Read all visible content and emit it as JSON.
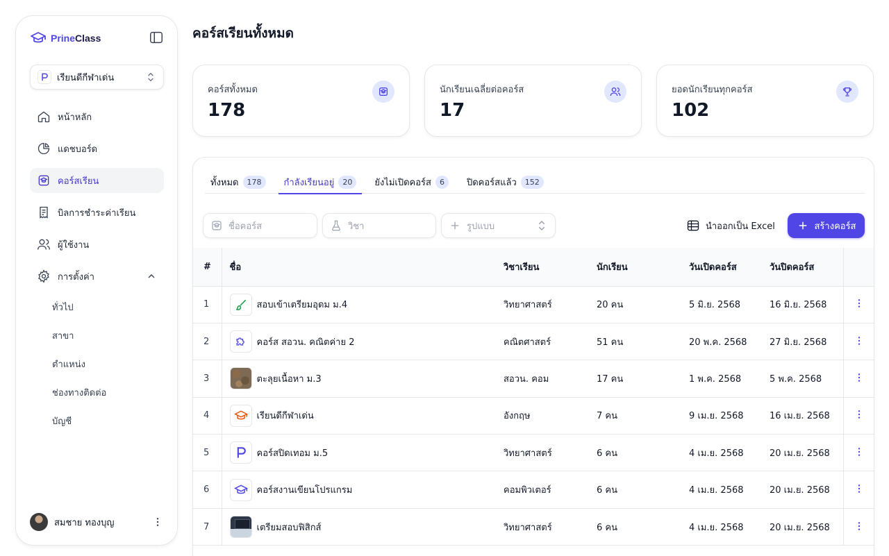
{
  "brand": {
    "name_prefix": "Prine",
    "name_suffix": "Class"
  },
  "school_selector": {
    "value": "เรียนดีกีฬาเด่น"
  },
  "nav": {
    "items": [
      {
        "label": "หน้าหลัก",
        "icon": "home-icon"
      },
      {
        "label": "แดชบอร์ด",
        "icon": "pie-chart-icon"
      },
      {
        "label": "คอร์สเรียน",
        "icon": "course-icon",
        "active": true
      },
      {
        "label": "บิลการชำระค่าเรียน",
        "icon": "receipt-icon"
      },
      {
        "label": "ผู้ใช้งาน",
        "icon": "users-icon"
      },
      {
        "label": "การตั้งค่า",
        "icon": "gear-icon",
        "expanded": true
      }
    ],
    "settings_sub": [
      "ทั่วไป",
      "สาขา",
      "ตำแหน่ง",
      "ช่องทางติดต่อ",
      "บัญชี"
    ]
  },
  "user": {
    "name": "สมชาย ทองบุญ"
  },
  "page": {
    "title": "คอร์สเรียนทั้งหมด"
  },
  "stats": [
    {
      "label": "คอร์สทั้งหมด",
      "value": "178",
      "icon": "course-icon"
    },
    {
      "label": "นักเรียนเฉลี่ยต่อคอร์ส",
      "value": "17",
      "icon": "users-icon"
    },
    {
      "label": "ยอดนักเรียนทุกคอร์ส",
      "value": "102",
      "icon": "trophy-icon"
    }
  ],
  "tabs": [
    {
      "label": "ทั้งหมด",
      "count": "178"
    },
    {
      "label": "กำลังเรียนอยู่",
      "count": "20",
      "active": true
    },
    {
      "label": "ยังไม่เปิดคอร์ส",
      "count": "6"
    },
    {
      "label": "ปิดคอร์สแล้ว",
      "count": "152"
    }
  ],
  "filters": {
    "course_name_placeholder": "ชื่อคอร์ส",
    "subject_placeholder": "วิชา",
    "format_placeholder": "รูปแบบ"
  },
  "actions": {
    "export_label": "นำออกเป็น Excel",
    "create_label": "สร้างคอร์ส"
  },
  "table": {
    "headers": {
      "num": "#",
      "name": "ชื่อ",
      "subject": "วิชาเรียน",
      "students": "นักเรียน",
      "open_date": "วันเปิดคอร์ส",
      "close_date": "วันปิดคอร์ส"
    },
    "rows": [
      {
        "num": "1",
        "name": "สอบเข้าเตรียมอุดม ม.4",
        "subject": "วิทยาศาสตร์",
        "students": "20 คน",
        "open_date": "5 มิ.ย. 2568",
        "close_date": "16 มิ.ย. 2568",
        "thumb": "brush-icon"
      },
      {
        "num": "2",
        "name": "คอร์ส สอวน. คณิตค่าย 2",
        "subject": "คณิตศาสตร์",
        "students": "51 คน",
        "open_date": "20 พ.ค. 2568",
        "close_date": "27 มิ.ย. 2568",
        "thumb": "puzzle-icon"
      },
      {
        "num": "3",
        "name": "ตะลุยเนื้อหา ม.3",
        "subject": "สอวน. คอม",
        "students": "17 คน",
        "open_date": "1 พ.ค. 2568",
        "close_date": "5 พ.ค. 2568",
        "thumb": "rock-photo"
      },
      {
        "num": "4",
        "name": "เรียนดีกีฬาเด่น",
        "subject": "อังกฤษ",
        "students": "7 คน",
        "open_date": "9 เม.ย. 2568",
        "close_date": "16 เม.ย. 2568",
        "thumb": "graduation-cap-icon"
      },
      {
        "num": "5",
        "name": "คอร์สปิดเทอม ม.5",
        "subject": "วิทยาศาสตร์",
        "students": "6 คน",
        "open_date": "4 เม.ย. 2568",
        "close_date": "20 เม.ย. 2568",
        "thumb": "p-logo-icon"
      },
      {
        "num": "6",
        "name": "คอร์สงานเขียนโปรแกรม",
        "subject": "คอมพิวเตอร์",
        "students": "6 คน",
        "open_date": "4 เม.ย. 2568",
        "close_date": "20 เม.ย. 2568",
        "thumb": "graduation-cap-icon"
      },
      {
        "num": "7",
        "name": "เตรียมสอบฟิสิกส์",
        "subject": "วิทยาศาสตร์",
        "students": "6 คน",
        "open_date": "4 เม.ย. 2568",
        "close_date": "20 เม.ย. 2568",
        "thumb": "classroom-photo"
      }
    ]
  },
  "colors": {
    "accent": "#4f46e5",
    "accent_light": "#e0e7ff",
    "border": "#e5e7eb"
  }
}
